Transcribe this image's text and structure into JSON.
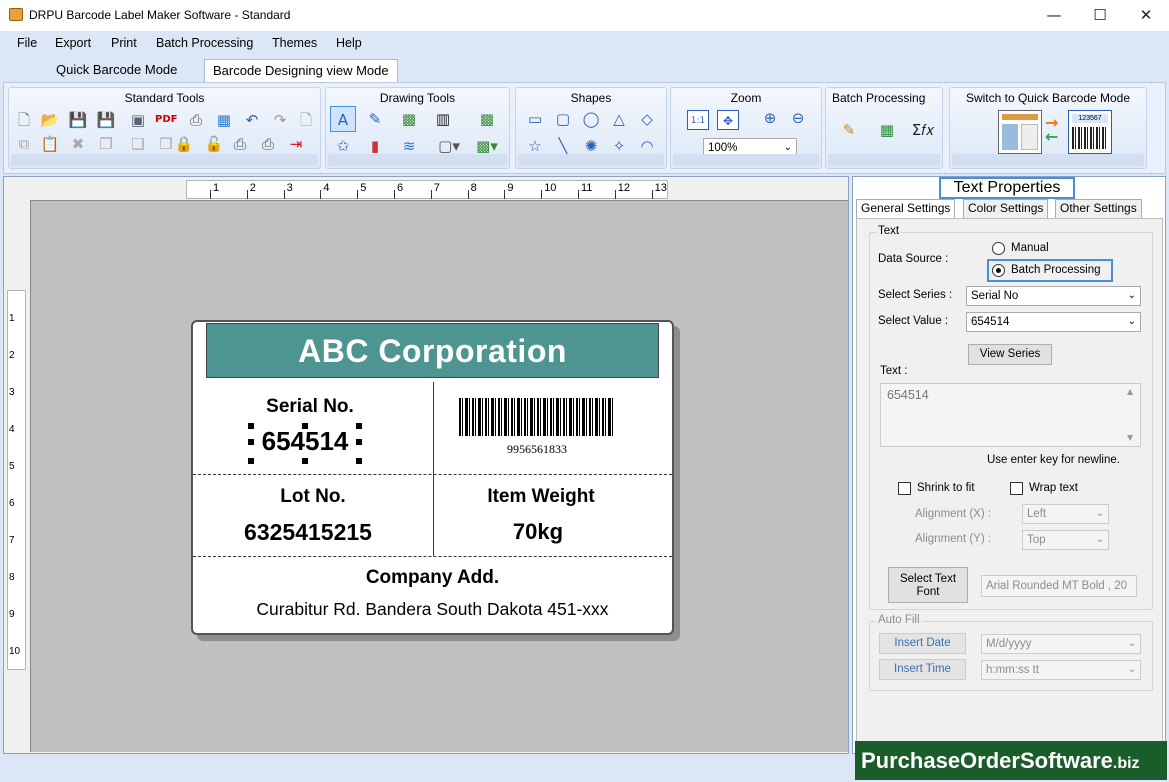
{
  "window": {
    "title": "DRPU Barcode Label Maker Software - Standard",
    "minimize": "—",
    "maximize": "☐",
    "close": "✕"
  },
  "menu": [
    "File",
    "Export",
    "Print",
    "Batch Processing",
    "Themes",
    "Help"
  ],
  "mode_tabs": {
    "quick": "Quick Barcode Mode",
    "design": "Barcode Designing view Mode"
  },
  "ribbon": {
    "standard_tools": "Standard Tools",
    "drawing_tools": "Drawing Tools",
    "shapes": "Shapes",
    "zoom": "Zoom",
    "zoom_value": "100%",
    "zoom_fit": "1:1",
    "batch_processing": "Batch Processing",
    "switch": "Switch to Quick Barcode Mode",
    "switch_number": "123567",
    "formula": "Σ𝑓𝑥"
  },
  "ruler": {
    "h": [
      "1",
      "2",
      "3",
      "4",
      "5",
      "6",
      "7",
      "8",
      "9",
      "10",
      "11",
      "12",
      "13"
    ],
    "v": [
      "1",
      "2",
      "3",
      "4",
      "5",
      "6",
      "7",
      "8",
      "9",
      "10"
    ]
  },
  "label": {
    "header": "ABC Corporation",
    "serial_title": "Serial No.",
    "serial_value": "654514",
    "barcode_number": "9956561833",
    "lot_title": "Lot No.",
    "lot_value": "6325415215",
    "weight_title": "Item Weight",
    "weight_value": "70kg",
    "company_title": "Company Add.",
    "company_value": "Curabitur Rd. Bandera South Dakota 451-xxx"
  },
  "panel": {
    "title": "Text Properties",
    "tabs": [
      "General Settings",
      "Color Settings",
      "Other Settings"
    ],
    "text_group": "Text",
    "data_source": "Data Source :",
    "manual": "Manual",
    "batch": "Batch Processing",
    "select_series_label": "Select Series :",
    "select_series_value": "Serial No",
    "select_value_label": "Select Value :",
    "select_value_value": "654514",
    "view_series": "View Series",
    "text_label": "Text :",
    "text_value": "654514",
    "hint": "Use enter key for newline.",
    "shrink": "Shrink to fit",
    "wrap": "Wrap text",
    "align_x_label": "Alignment (X) :",
    "align_x_value": "Left",
    "align_y_label": "Alignment (Y) :",
    "align_y_value": "Top",
    "select_font": "Select Text Font",
    "font_value": "Arial Rounded MT Bold , 20",
    "autofill": "Auto Fill",
    "insert_date": "Insert Date",
    "date_format": "M/d/yyyy",
    "insert_time": "Insert Time",
    "time_format": "h:mm:ss tt"
  },
  "watermark": {
    "main": "PurchaseOrderSoftware",
    "suffix": ".biz"
  }
}
